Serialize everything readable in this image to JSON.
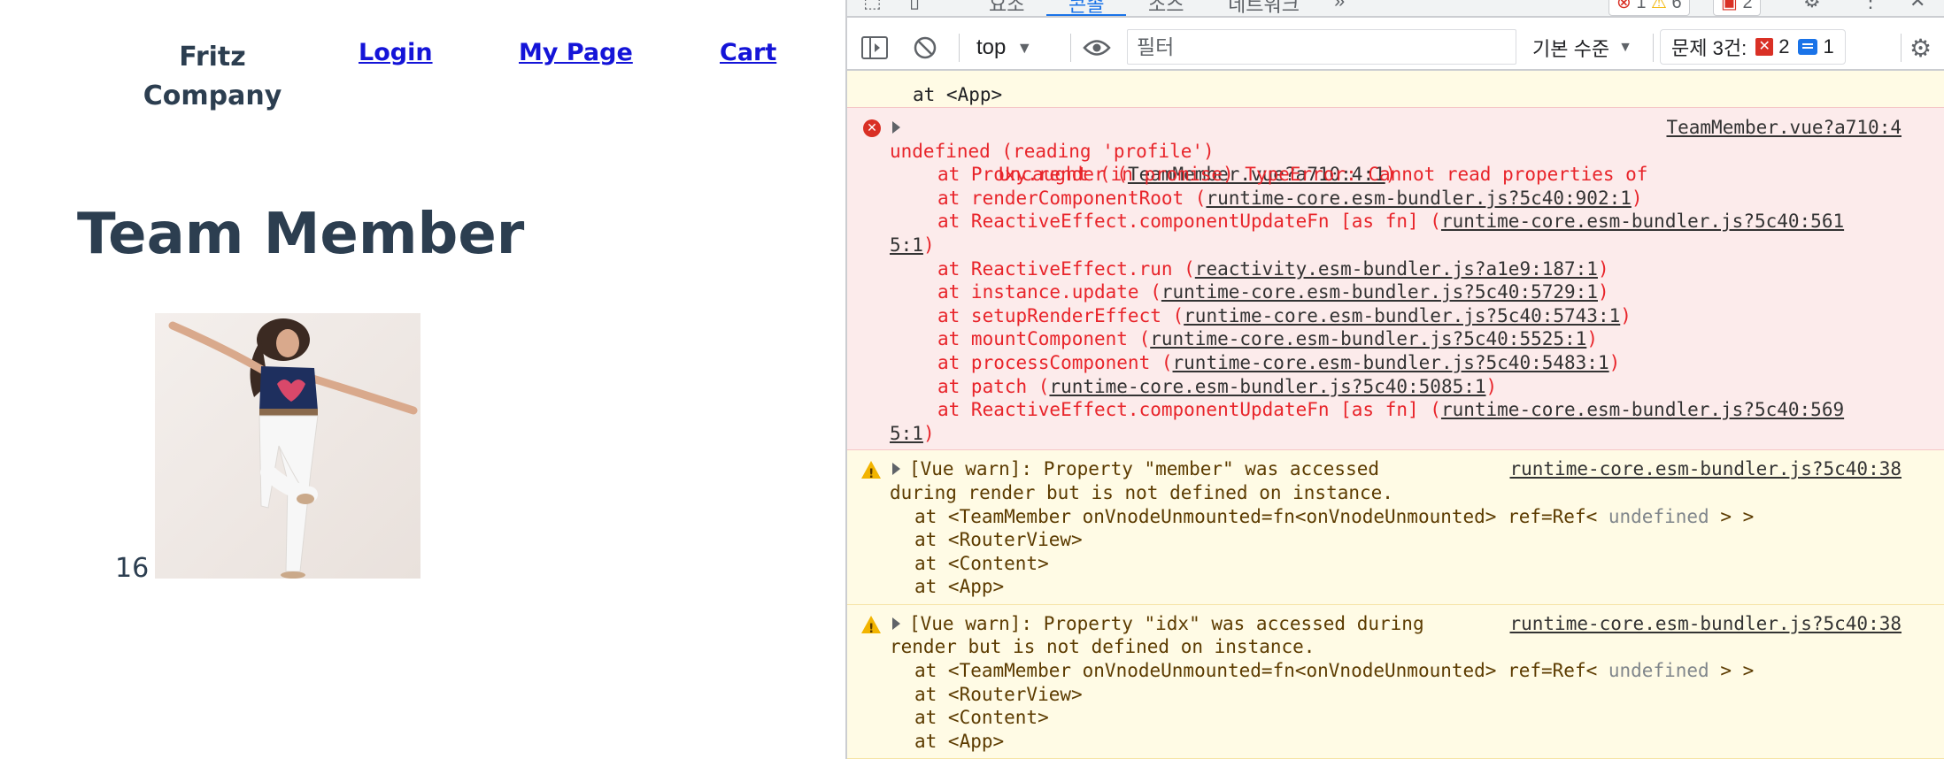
{
  "page": {
    "brand": "Fritz Company",
    "nav": {
      "login": "Login",
      "my_page": "My Page",
      "cart": "Cart"
    },
    "title": "Team Member",
    "member_idx": "16"
  },
  "devtools": {
    "tabs": [
      "요소",
      "콘솔",
      "소스",
      "네트워크"
    ],
    "more_tabs": "»",
    "error_count": "1",
    "warning_count": "6",
    "issue_count_top": "2",
    "toolbar": {
      "context": "top",
      "filter_placeholder": "필터",
      "levels": "기본 수준",
      "issues_label": "문제 3건:",
      "issues_errors": "2",
      "issues_info": "1"
    },
    "console": {
      "prev_tail": "at <App>",
      "error": {
        "line1": "Uncaught (in promise) TypeError: Cannot read properties of",
        "line2": "undefined (reading 'profile')",
        "source": "TeamMember.vue?a710:4",
        "stack": [
          {
            "prefix": "at Proxy.render (",
            "link": "TeamMember.vue?a710:4:1",
            "suffix": ")"
          },
          {
            "prefix": "at renderComponentRoot (",
            "link": "runtime-core.esm-bundler.js?5c40:902:1",
            "suffix": ")"
          },
          {
            "prefix": "at ReactiveEffect.componentUpdateFn [as fn] (",
            "link": "runtime-core.esm-bundler.js?5c40:561",
            "cont": "5:1",
            "suffix": ")"
          },
          {
            "prefix": "at ReactiveEffect.run (",
            "link": "reactivity.esm-bundler.js?a1e9:187:1",
            "suffix": ")"
          },
          {
            "prefix": "at instance.update (",
            "link": "runtime-core.esm-bundler.js?5c40:5729:1",
            "suffix": ")"
          },
          {
            "prefix": "at setupRenderEffect (",
            "link": "runtime-core.esm-bundler.js?5c40:5743:1",
            "suffix": ")"
          },
          {
            "prefix": "at mountComponent (",
            "link": "runtime-core.esm-bundler.js?5c40:5525:1",
            "suffix": ")"
          },
          {
            "prefix": "at processComponent (",
            "link": "runtime-core.esm-bundler.js?5c40:5483:1",
            "suffix": ")"
          },
          {
            "prefix": "at patch (",
            "link": "runtime-core.esm-bundler.js?5c40:5085:1",
            "suffix": ")"
          },
          {
            "prefix": "at ReactiveEffect.componentUpdateFn [as fn] (",
            "link": "runtime-core.esm-bundler.js?5c40:569",
            "cont": "5:1",
            "suffix": ")"
          }
        ]
      },
      "warnings": [
        {
          "line1": "[Vue warn]: Property \"member\" was accessed",
          "line2": "during render but is not defined on instance.",
          "source": "runtime-core.esm-bundler.js?5c40:38",
          "trace": [
            "at <TeamMember onVnodeUnmounted=fn<onVnodeUnmounted> ref=Ref< ",
            "undefined",
            " > >",
            "at <RouterView>",
            "at <Content>",
            "at <App>"
          ]
        },
        {
          "line1": "[Vue warn]: Property \"idx\" was accessed during",
          "line2": "render but is not defined on instance.",
          "source": "runtime-core.esm-bundler.js?5c40:38",
          "trace": [
            "at <TeamMember onVnodeUnmounted=fn<onVnodeUnmounted> ref=Ref< ",
            "undefined",
            " > >",
            "at <RouterView>",
            "at <Content>",
            "at <App>"
          ]
        }
      ]
    }
  }
}
